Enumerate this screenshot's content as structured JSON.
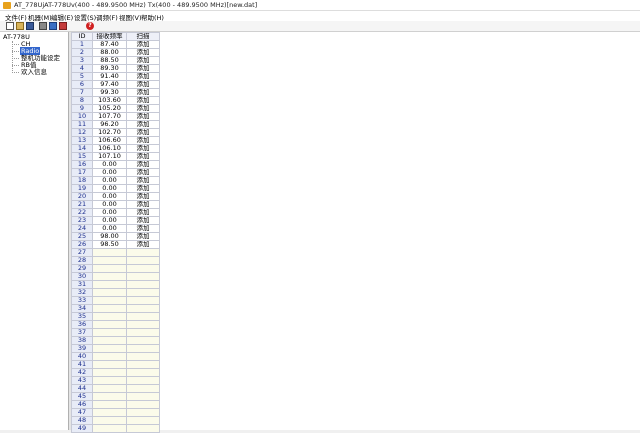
{
  "window": {
    "title": "AT_778UjAT-778Uv(400 - 489.9500 MHz) Tx(400 - 489.9500 MHz)[new.dat]"
  },
  "menu": [
    "文件(F)",
    "机器(M)",
    "编辑(E)",
    "设置(S)",
    "调频(F)",
    "视图(V)",
    "帮助(H)"
  ],
  "toolbar": {
    "buttons": [
      "new-icon",
      "open-icon",
      "save-icon",
      "print-icon",
      "read-icon",
      "write-icon",
      "help-icon"
    ],
    "help_glyph": "?"
  },
  "tree": {
    "root": "AT-778U",
    "items": [
      "CH",
      "Radio",
      "整机功能设定",
      "RB值",
      "欢入信息"
    ],
    "selected": "Radio"
  },
  "table": {
    "headers": [
      "ID",
      "接收频率",
      "扫描"
    ],
    "rows": [
      [
        "1",
        "87.40",
        "添加"
      ],
      [
        "2",
        "88.00",
        "添加"
      ],
      [
        "3",
        "88.50",
        "添加"
      ],
      [
        "4",
        "89.30",
        "添加"
      ],
      [
        "5",
        "91.40",
        "添加"
      ],
      [
        "6",
        "97.40",
        "添加"
      ],
      [
        "7",
        "99.30",
        "添加"
      ],
      [
        "8",
        "103.60",
        "添加"
      ],
      [
        "9",
        "105.20",
        "添加"
      ],
      [
        "10",
        "107.70",
        "添加"
      ],
      [
        "11",
        "96.20",
        "添加"
      ],
      [
        "12",
        "102.70",
        "添加"
      ],
      [
        "13",
        "106.60",
        "添加"
      ],
      [
        "14",
        "106.10",
        "添加"
      ],
      [
        "15",
        "107.10",
        "添加"
      ],
      [
        "16",
        "0.00",
        "添加"
      ],
      [
        "17",
        "0.00",
        "添加"
      ],
      [
        "18",
        "0.00",
        "添加"
      ],
      [
        "19",
        "0.00",
        "添加"
      ],
      [
        "20",
        "0.00",
        "添加"
      ],
      [
        "21",
        "0.00",
        "添加"
      ],
      [
        "22",
        "0.00",
        "添加"
      ],
      [
        "23",
        "0.00",
        "添加"
      ],
      [
        "24",
        "0.00",
        "添加"
      ],
      [
        "25",
        "98.00",
        "添加"
      ],
      [
        "26",
        "98.50",
        "添加"
      ],
      [
        "27",
        "",
        ""
      ],
      [
        "28",
        "",
        ""
      ],
      [
        "29",
        "",
        ""
      ],
      [
        "30",
        "",
        ""
      ],
      [
        "31",
        "",
        ""
      ],
      [
        "32",
        "",
        ""
      ],
      [
        "33",
        "",
        ""
      ],
      [
        "34",
        "",
        ""
      ],
      [
        "35",
        "",
        ""
      ],
      [
        "36",
        "",
        ""
      ],
      [
        "37",
        "",
        ""
      ],
      [
        "38",
        "",
        ""
      ],
      [
        "39",
        "",
        ""
      ],
      [
        "40",
        "",
        ""
      ],
      [
        "41",
        "",
        ""
      ],
      [
        "42",
        "",
        ""
      ],
      [
        "43",
        "",
        ""
      ],
      [
        "44",
        "",
        ""
      ],
      [
        "45",
        "",
        ""
      ],
      [
        "46",
        "",
        ""
      ],
      [
        "47",
        "",
        ""
      ],
      [
        "48",
        "",
        ""
      ],
      [
        "49",
        "",
        ""
      ]
    ]
  }
}
